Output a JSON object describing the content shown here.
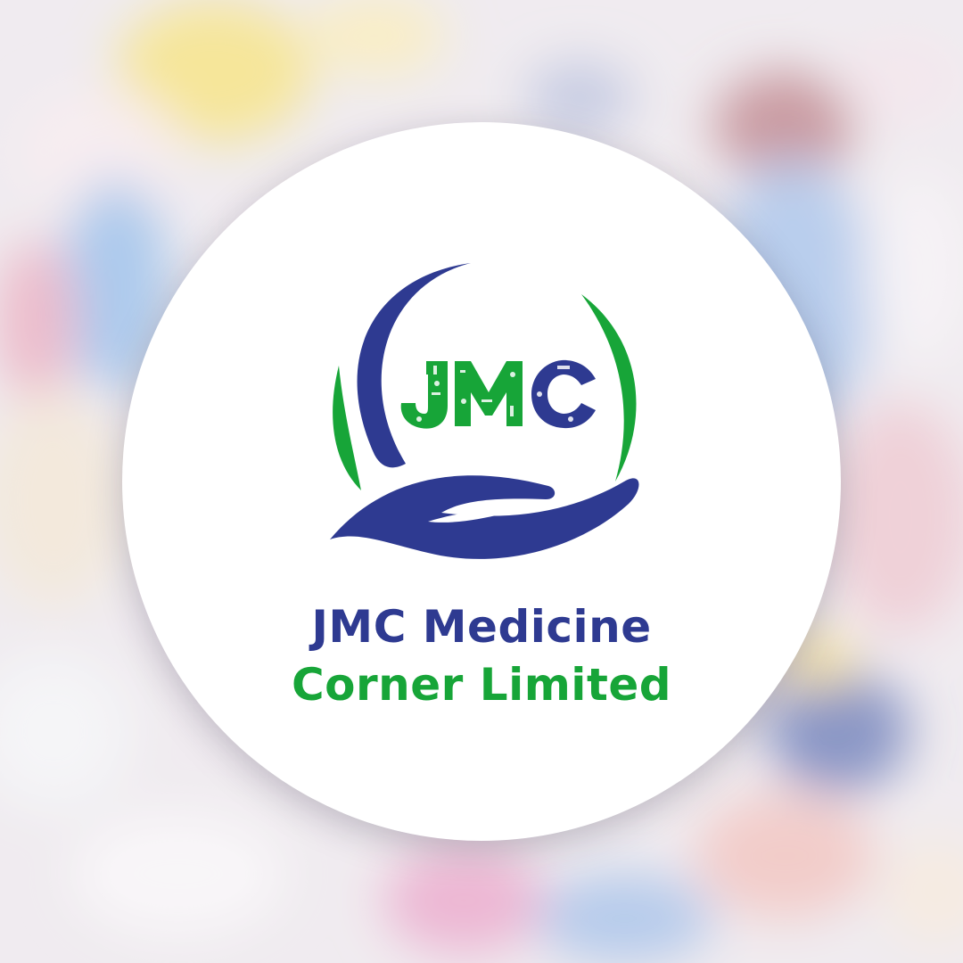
{
  "logo": {
    "monogram": "JMC",
    "company_name_line1": "JMC Medicine",
    "company_name_line2": "Corner Limited"
  },
  "colors": {
    "navy": "#2e3a91",
    "green": "#17a538",
    "badge_background": "#ffffff"
  },
  "background": {
    "description_icon": "blurred-pills-backdrop"
  }
}
